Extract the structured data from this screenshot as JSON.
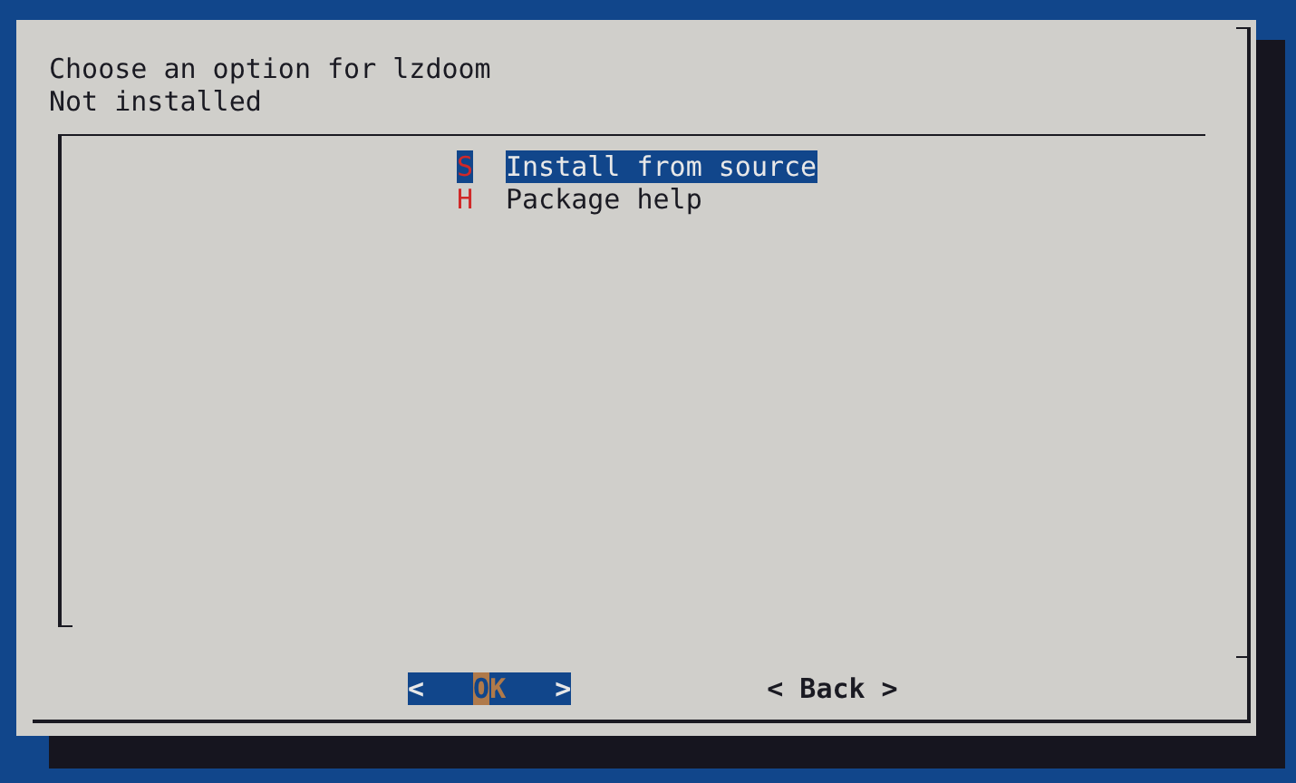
{
  "dialog": {
    "title": "Choose an option for lzdoom",
    "subtitle": "Not installed"
  },
  "menu": {
    "items": [
      {
        "hotkey": "S",
        "label": "Install from source",
        "selected": true
      },
      {
        "hotkey": "H",
        "label": "Package help",
        "selected": false
      }
    ]
  },
  "buttons": [
    {
      "left": "<",
      "hotkey": "O",
      "rest": "K",
      "right": ">",
      "selected": true
    },
    {
      "left": "<",
      "hotkey": "B",
      "rest": "ack",
      "right": ">",
      "selected": false
    }
  ]
}
